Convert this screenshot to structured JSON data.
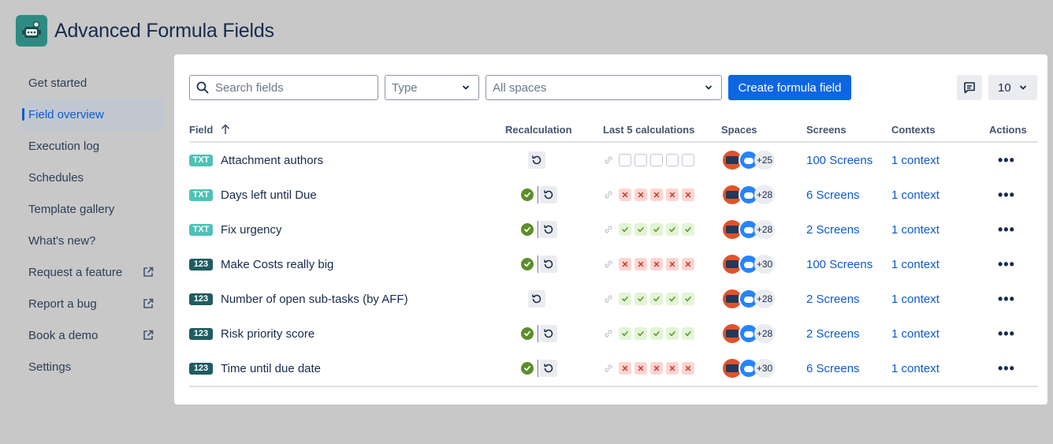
{
  "app": {
    "title": "Advanced Formula Fields",
    "logo_icon": "robot-logo-icon"
  },
  "sidebar": {
    "items": [
      {
        "label": "Get started",
        "external": false,
        "active": false
      },
      {
        "label": "Field overview",
        "external": false,
        "active": true
      },
      {
        "label": "Execution log",
        "external": false,
        "active": false
      },
      {
        "label": "Schedules",
        "external": false,
        "active": false
      },
      {
        "label": "Template gallery",
        "external": false,
        "active": false
      },
      {
        "label": "What's new?",
        "external": false,
        "active": false
      },
      {
        "label": "Request a feature",
        "external": true,
        "active": false
      },
      {
        "label": "Report a bug",
        "external": true,
        "active": false
      },
      {
        "label": "Book a demo",
        "external": true,
        "active": false
      },
      {
        "label": "Settings",
        "external": false,
        "active": false
      }
    ]
  },
  "toolbar": {
    "search_placeholder": "Search fields",
    "type_placeholder": "Type",
    "spaces_value": "All spaces",
    "create_label": "Create formula field",
    "page_size": "10"
  },
  "table": {
    "headers": {
      "field": "Field",
      "recalc": "Recalculation",
      "last5": "Last 5 calculations",
      "spaces": "Spaces",
      "screens": "Screens",
      "contexts": "Contexts",
      "actions": "Actions"
    },
    "rows": [
      {
        "type": "TXT",
        "name": "Attachment authors",
        "recalc_status": "none",
        "last5": [
          "empty",
          "empty",
          "empty",
          "empty",
          "empty"
        ],
        "spaces_count": "25",
        "screens": "100 Screens",
        "contexts": "1 context"
      },
      {
        "type": "TXT",
        "name": "Days left until Due",
        "recalc_status": "done",
        "last5": [
          "fail",
          "fail",
          "fail",
          "fail",
          "fail"
        ],
        "spaces_count": "28",
        "screens": "6 Screens",
        "contexts": "1 context"
      },
      {
        "type": "TXT",
        "name": "Fix urgency",
        "recalc_status": "done",
        "last5": [
          "ok",
          "ok",
          "ok",
          "ok",
          "ok"
        ],
        "spaces_count": "28",
        "screens": "2 Screens",
        "contexts": "1 context"
      },
      {
        "type": "123",
        "name": "Make Costs really big",
        "recalc_status": "done",
        "last5": [
          "fail",
          "fail",
          "fail",
          "fail",
          "fail"
        ],
        "spaces_count": "30",
        "screens": "100 Screens",
        "contexts": "1 context"
      },
      {
        "type": "123",
        "name": "Number of open sub-tasks (by AFF)",
        "recalc_status": "none",
        "last5": [
          "ok",
          "ok",
          "ok",
          "ok",
          "ok"
        ],
        "spaces_count": "28",
        "screens": "2 Screens",
        "contexts": "1 context"
      },
      {
        "type": "123",
        "name": "Risk priority score",
        "recalc_status": "done",
        "last5": [
          "ok",
          "ok",
          "ok",
          "ok",
          "ok"
        ],
        "spaces_count": "28",
        "screens": "2 Screens",
        "contexts": "1 context"
      },
      {
        "type": "123",
        "name": "Time until due date",
        "recalc_status": "done",
        "last5": [
          "fail",
          "fail",
          "fail",
          "fail",
          "fail"
        ],
        "spaces_count": "30",
        "screens": "6 Screens",
        "contexts": "1 context"
      }
    ]
  },
  "colors": {
    "accent": "#0c66e4",
    "ok": "#5b8f2a",
    "fail": "#c9372c",
    "txt_badge": "#4fc1b6",
    "num_badge": "#1f5c61"
  }
}
